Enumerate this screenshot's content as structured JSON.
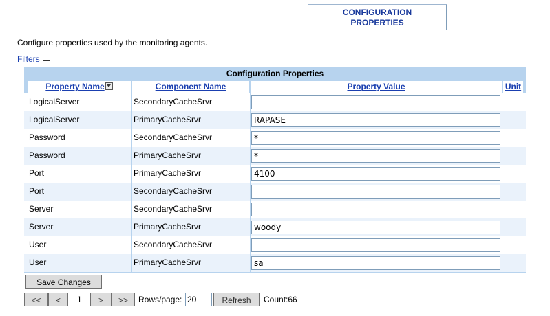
{
  "tab": {
    "line1": "CONFIGURATION",
    "line2": "PROPERTIES"
  },
  "description": "Configure properties used by the monitoring agents.",
  "filters_label": "Filters",
  "grid": {
    "title": "Configuration Properties",
    "columns": {
      "property": "Property Name",
      "component": "Component Name",
      "value": "Property Value",
      "unit": "Unit"
    },
    "rows": [
      {
        "property": "LogicalServer",
        "component": "SecondaryCacheSrvr",
        "value": ""
      },
      {
        "property": "LogicalServer",
        "component": "PrimaryCacheSrvr",
        "value": "RAPASE"
      },
      {
        "property": "Password",
        "component": "SecondaryCacheSrvr",
        "value": "*"
      },
      {
        "property": "Password",
        "component": "PrimaryCacheSrvr",
        "value": "*"
      },
      {
        "property": "Port",
        "component": "PrimaryCacheSrvr",
        "value": "4100"
      },
      {
        "property": "Port",
        "component": "SecondaryCacheSrvr",
        "value": ""
      },
      {
        "property": "Server",
        "component": "SecondaryCacheSrvr",
        "value": ""
      },
      {
        "property": "Server",
        "component": "PrimaryCacheSrvr",
        "value": "woody"
      },
      {
        "property": "User",
        "component": "SecondaryCacheSrvr",
        "value": ""
      },
      {
        "property": "User",
        "component": "PrimaryCacheSrvr",
        "value": "sa"
      }
    ]
  },
  "save_label": "Save Changes",
  "pager": {
    "first": "<<",
    "prev": "<",
    "page": "1",
    "next": ">",
    "last": ">>",
    "rows_label": "Rows/page:",
    "rows_value": "20",
    "refresh": "Refresh",
    "count": "Count:66"
  }
}
